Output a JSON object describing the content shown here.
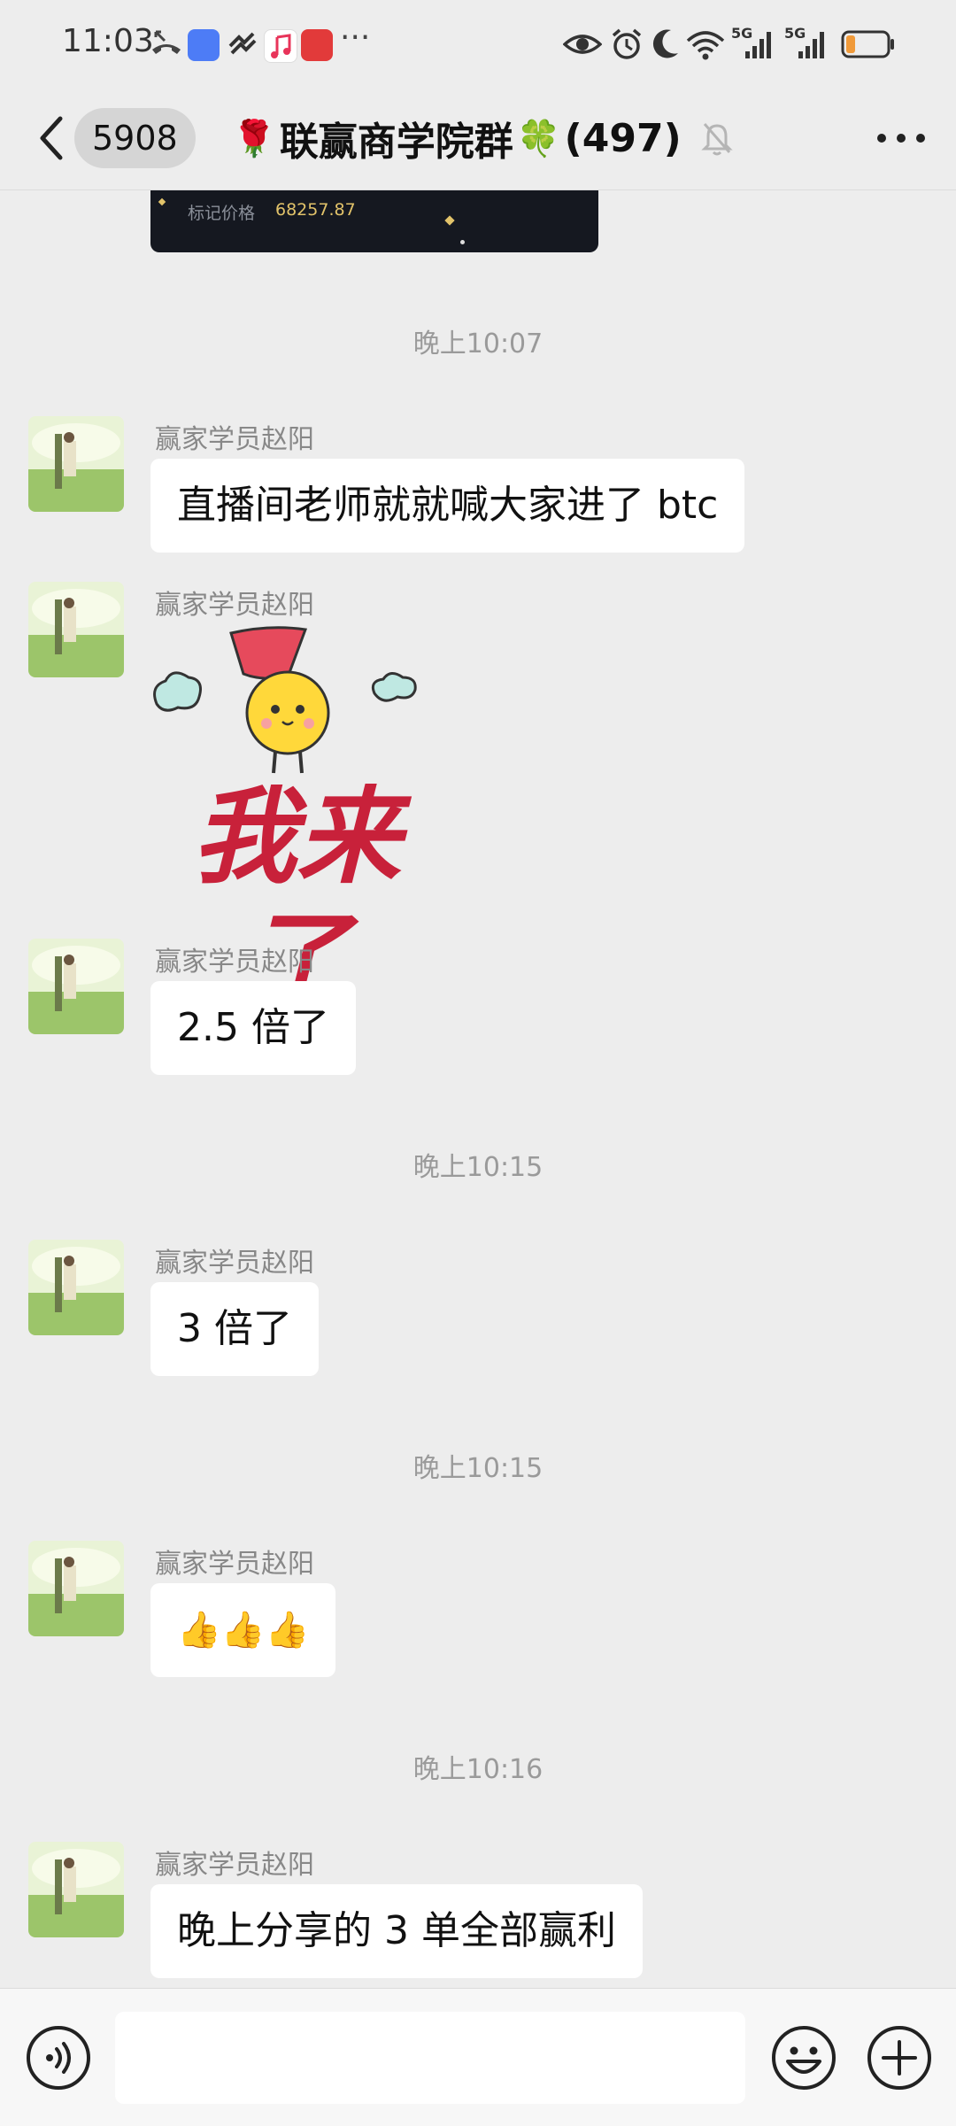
{
  "status_bar": {
    "time": "11:03",
    "network_1": "5G",
    "network_2": "5G",
    "overflow": "···",
    "icons": [
      "missed-call-icon",
      "app-icon",
      "app-icon",
      "music-app-icon",
      "news-app-icon",
      "eye-icon",
      "alarm-icon",
      "moon-icon",
      "wifi-icon",
      "signal-icon",
      "signal-icon",
      "battery-icon"
    ]
  },
  "nav": {
    "unread_count": "5908",
    "title_prefix_emoji": "🌹",
    "title": "联赢商学院群",
    "title_suffix_emoji": "🍀",
    "member_count": "(497)",
    "muted_icon": "bell-off-icon",
    "more_icon": "more-dots-icon"
  },
  "image_message": {
    "label": "标记价格",
    "value": "68257.87"
  },
  "messages": [
    {
      "type": "timestamp",
      "text": "晚上10:07"
    },
    {
      "type": "text",
      "sender": "赢家学员赵阳",
      "text": "直播间老师就就喊大家进了 btc"
    },
    {
      "type": "sticker",
      "sender": "赢家学员赵阳",
      "text": "我来了"
    },
    {
      "type": "text",
      "sender": "赢家学员赵阳",
      "text": "2.5 倍了"
    },
    {
      "type": "timestamp",
      "text": "晚上10:15"
    },
    {
      "type": "text",
      "sender": "赢家学员赵阳",
      "text": "3 倍了"
    },
    {
      "type": "timestamp",
      "text": "晚上10:15"
    },
    {
      "type": "text",
      "sender": "赢家学员赵阳",
      "text": "👍👍👍"
    },
    {
      "type": "timestamp",
      "text": "晚上10:16"
    },
    {
      "type": "text",
      "sender": "赢家学员赵阳",
      "text": "晚上分享的 3 单全部赢利"
    }
  ],
  "input_bar": {
    "placeholder": "",
    "voice_icon": "voice-icon",
    "emoji_icon": "emoji-icon",
    "plus_icon": "plus-icon"
  },
  "colors": {
    "background": "#ededed",
    "bubble": "#ffffff",
    "timestamp": "#9a9a9a",
    "sticker_text": "#c8213a"
  }
}
